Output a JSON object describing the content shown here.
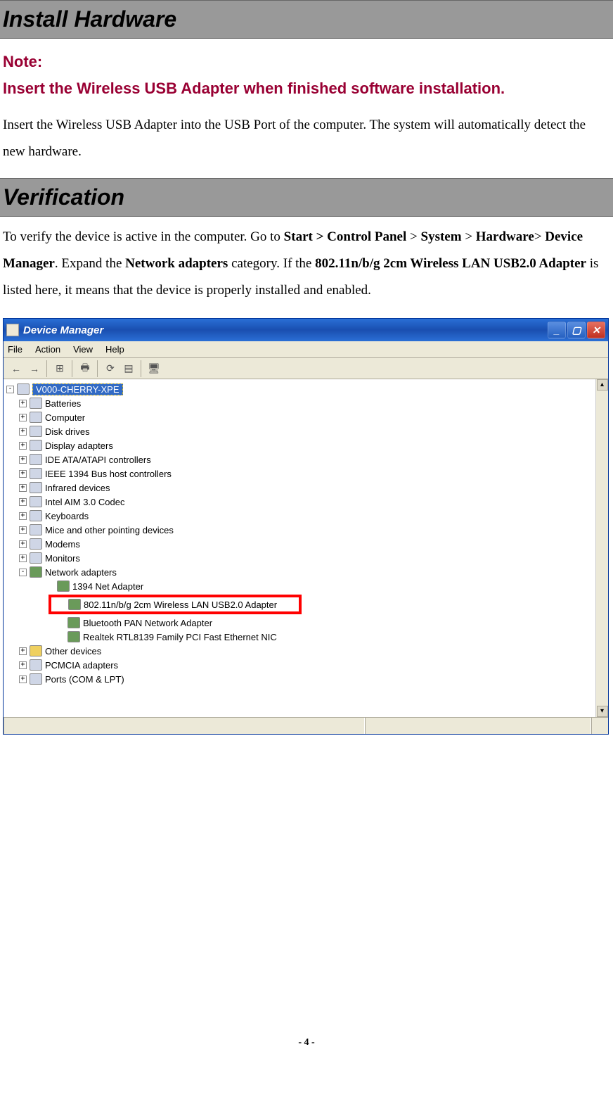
{
  "headings": {
    "install": "Install Hardware",
    "verify": "Verification"
  },
  "note": {
    "label": "Note:",
    "text": "Insert the Wireless USB Adapter when finished software installation."
  },
  "paragraphs": {
    "install_body": "Insert the Wireless USB Adapter into the USB Port of the computer. The system will automatically detect the new hardware."
  },
  "verify_text": {
    "p1": "To verify the device is active in the computer. Go to ",
    "b1": "Start > Control Panel",
    "p2": " > ",
    "b2": "System",
    "p3": " > ",
    "b3": "Hardware",
    "p4": "> ",
    "b4": "Device Manager",
    "p5": ". Expand the ",
    "b5": "Network adapters",
    "p6": " category. If the ",
    "b6": "802.11n/b/g 2cm Wireless LAN USB2.0 Adapter",
    "p7": " is listed here, it means that the device is properly installed and enabled."
  },
  "device_manager": {
    "title": "Device Manager",
    "menu": {
      "file": "File",
      "action": "Action",
      "view": "View",
      "help": "Help"
    },
    "root": "V000-CHERRY-XPE",
    "nodes_top": [
      "Batteries",
      "Computer",
      "Disk drives",
      "Display adapters",
      "IDE ATA/ATAPI controllers",
      "IEEE 1394 Bus host controllers",
      "Infrared devices",
      "Intel AIM 3.0 Codec",
      "Keyboards",
      "Mice and other pointing devices",
      "Modems",
      "Monitors"
    ],
    "network_label": "Network adapters",
    "network_children_pre": "1394 Net Adapter",
    "highlighted": "802.11n/b/g 2cm Wireless LAN USB2.0 Adapter",
    "network_children_post": [
      "Bluetooth PAN Network Adapter",
      "Realtek RTL8139 Family PCI Fast Ethernet NIC"
    ],
    "nodes_bottom": [
      "Other devices",
      "PCMCIA adapters",
      "Ports (COM & LPT)"
    ]
  },
  "footer": "- 4 -"
}
